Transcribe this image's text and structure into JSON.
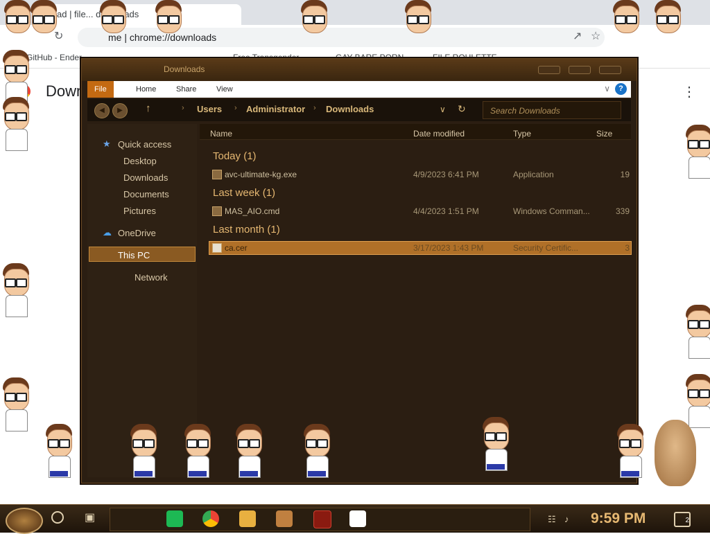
{
  "browser": {
    "tab_title": "ad | file... downloads",
    "url_text": "me  |  chrome://downloads",
    "heading": "Downloads",
    "bookmarks": [
      "GitHub - Ender...",
      "Free Transgender...",
      "GAY BARE PORN",
      "FILE ROULETTE"
    ]
  },
  "explorer": {
    "title": "Downloads",
    "ribbon_tabs": [
      "File",
      "Home",
      "Share",
      "View"
    ],
    "help_label": "?",
    "address": {
      "segments": [
        "Users",
        "Administrator",
        "Downloads"
      ]
    },
    "search_placeholder": "Search Downloads",
    "nav": {
      "quick_access": "Quick access",
      "desktop": "Desktop",
      "downloads": "Downloads",
      "documents": "Documents",
      "pictures": "Pictures",
      "onedrive": "OneDrive",
      "this_pc": "This PC",
      "network": "Network"
    },
    "columns": {
      "name": "Name",
      "date": "Date modified",
      "type": "Type",
      "size": "Size"
    },
    "groups": [
      {
        "label": "Today (1)",
        "files": [
          {
            "name": "avc-ultimate-kg.exe",
            "date": "4/9/2023 6:41 PM",
            "type": "Application",
            "size": "19"
          }
        ]
      },
      {
        "label": "Last week (1)",
        "files": [
          {
            "name": "MAS_AIO.cmd",
            "date": "4/4/2023 1:51 PM",
            "type": "Windows Comman...",
            "size": "339"
          }
        ]
      },
      {
        "label": "Last month (1)",
        "files": [
          {
            "name": "ca.cer",
            "date": "3/17/2023 1:43 PM",
            "type": "Security Certific...",
            "size": "3"
          }
        ]
      }
    ]
  },
  "taskbar": {
    "clock": "9:59 PM",
    "notification_count": "2"
  },
  "colors": {
    "accent": "#c46a12",
    "window_bg": "#2b1e12",
    "selection": "#b07028",
    "text_gold": "#e6b872"
  }
}
